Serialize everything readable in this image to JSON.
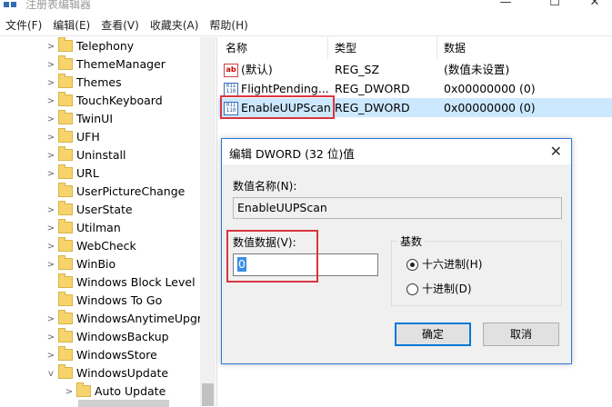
{
  "window": {
    "title": "注册表编辑器",
    "min": "—",
    "max": "☐",
    "close": "✕"
  },
  "menu": [
    "文件(F)",
    "编辑(E)",
    "查看(V)",
    "收藏夹(A)",
    "帮助(H)"
  ],
  "tree": [
    {
      "label": "Telephony",
      "expand": ">"
    },
    {
      "label": "ThemeManager",
      "expand": ">"
    },
    {
      "label": "Themes",
      "expand": ">"
    },
    {
      "label": "TouchKeyboard",
      "expand": ">"
    },
    {
      "label": "TwinUI",
      "expand": ">"
    },
    {
      "label": "UFH",
      "expand": ">"
    },
    {
      "label": "Uninstall",
      "expand": ">"
    },
    {
      "label": "URL",
      "expand": ">"
    },
    {
      "label": "UserPictureChange",
      "expand": ""
    },
    {
      "label": "UserState",
      "expand": ">"
    },
    {
      "label": "Utilman",
      "expand": ">"
    },
    {
      "label": "WebCheck",
      "expand": ">"
    },
    {
      "label": "WinBio",
      "expand": ">"
    },
    {
      "label": "Windows Block Level",
      "expand": ""
    },
    {
      "label": "Windows To Go",
      "expand": ""
    },
    {
      "label": "WindowsAnytimeUpgr",
      "expand": ">"
    },
    {
      "label": "WindowsBackup",
      "expand": ">"
    },
    {
      "label": "WindowsStore",
      "expand": ">"
    },
    {
      "label": "WindowsUpdate",
      "expand": "v"
    },
    {
      "label": "Auto Update",
      "expand": ">"
    }
  ],
  "list": {
    "columns": [
      "名称",
      "类型",
      "数据"
    ],
    "rows": [
      {
        "icon": "ab",
        "name": "(默认)",
        "type": "REG_SZ",
        "data": "(数值未设置)"
      },
      {
        "icon": "bin",
        "name": "FlightPending...",
        "type": "REG_DWORD",
        "data": "0x00000000 (0)"
      },
      {
        "icon": "bin",
        "name": "EnableUUPScan",
        "type": "REG_DWORD",
        "data": "0x00000000 (0)"
      }
    ]
  },
  "dialog": {
    "title": "编辑 DWORD (32 位)值",
    "close": "✕",
    "value_name_label": "数值名称(N):",
    "value_name": "EnableUUPScan",
    "value_data_label": "数值数据(V):",
    "value_data": "0",
    "base_label": "基数",
    "hex_label": "十六进制(H)",
    "dec_label": "十进制(D)",
    "ok": "确定",
    "cancel": "取消"
  },
  "colors": {
    "accent": "#0078d7",
    "highlight": "#d9363e",
    "selection": "#cce8ff"
  },
  "icons": [
    "app-regedit-icon",
    "folder-icon",
    "chevron-right-icon",
    "chevron-down-icon",
    "string-value-icon",
    "binary-value-icon",
    "radio-icon"
  ]
}
